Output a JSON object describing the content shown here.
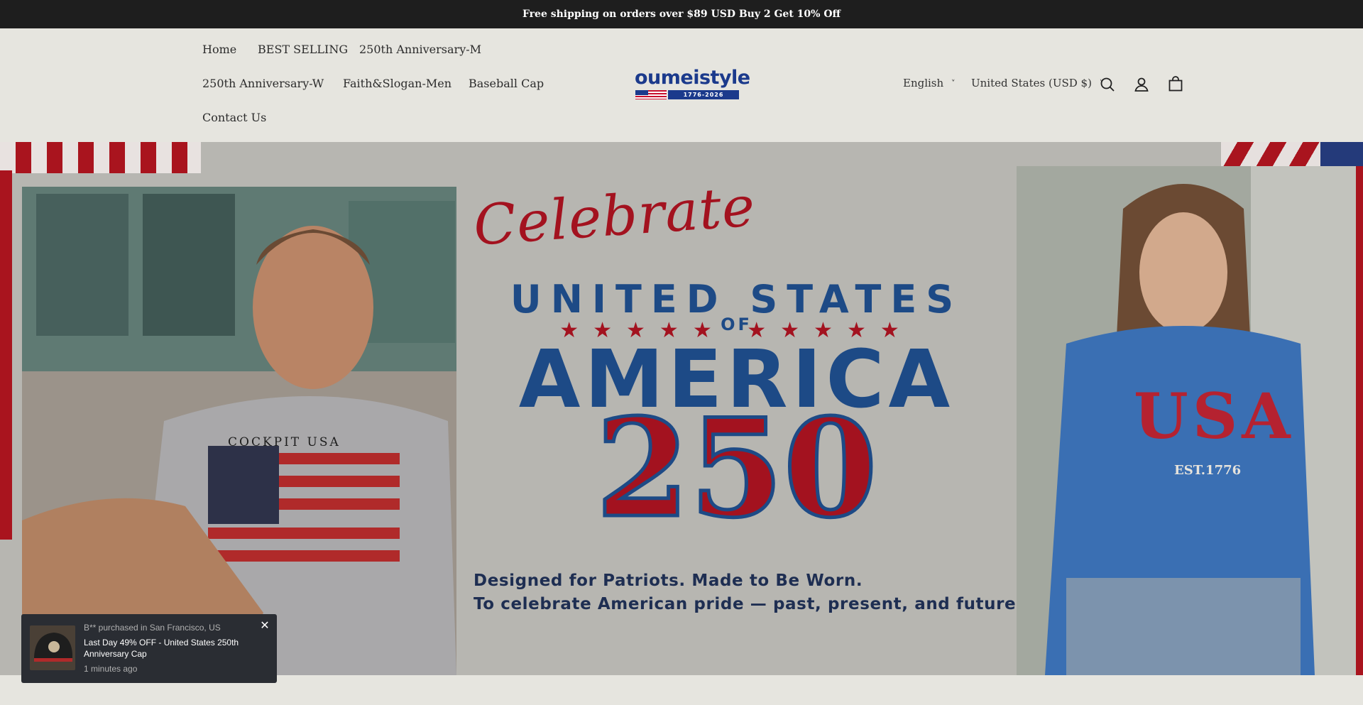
{
  "announcement": {
    "text": "Free shipping on orders over $89 USD  Buy 2 Get 10% Off"
  },
  "nav": {
    "items": [
      {
        "label": "Home"
      },
      {
        "label": "BEST SELLING"
      },
      {
        "label": "250th Anniversary-M"
      },
      {
        "label": "250th Anniversary-W"
      },
      {
        "label": "Faith&Slogan-Men"
      },
      {
        "label": "Baseball Cap"
      },
      {
        "label": "Contact Us"
      }
    ]
  },
  "logo": {
    "text": "oumeistyle",
    "years": "1776-2026"
  },
  "language": {
    "label": "English"
  },
  "currency": {
    "label": "United States (USD $)"
  },
  "icons": {
    "search": "search-icon",
    "account": "user-icon",
    "cart": "bag-icon",
    "close": "close-icon",
    "chevron": "chevron-down-icon"
  },
  "hero": {
    "celebrate": "Celebrate",
    "united_states": "UNITED STATES",
    "of": "OF",
    "stars": "★★★★★    ★★★★★",
    "america": "AMERICA",
    "number": "250",
    "tagline_1": "Designed for Patriots. Made to Be Worn.",
    "tagline_2": "To celebrate American pride — past, present, and future.",
    "left_shirt_text": "COCKPIT USA",
    "right_shirt_text": "USA",
    "right_shirt_sub": "EST.1776"
  },
  "popup": {
    "who": "B** purchased in San Francisco, US",
    "what": "Last Day 49% OFF - United States 250th Anniversary Cap",
    "when": "1 minutes ago"
  },
  "colors": {
    "brand_blue": "#1b3a8c",
    "flag_red": "#a9141e",
    "announcement_bg": "#1e1e1e",
    "header_bg": "#e6e5df"
  }
}
